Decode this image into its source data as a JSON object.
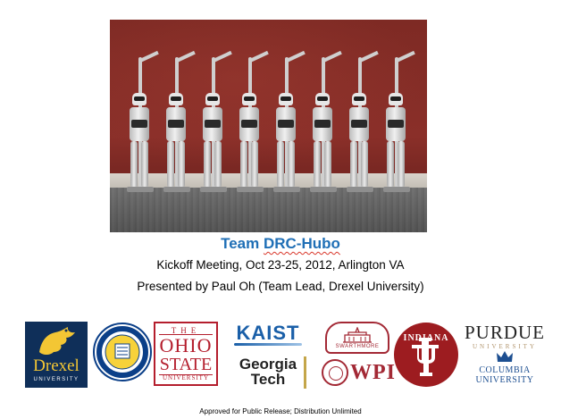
{
  "caption": {
    "title_prefix": "Team ",
    "title_name": "DRC-Hubo",
    "subtitle": "Kickoff Meeting, Oct 23-25, 2012, Arlington VA",
    "presenter": "Presented by Paul Oh (Team Lead, Drexel University)"
  },
  "photo": {
    "robot_count": 8,
    "alt_icon": "robot-photo"
  },
  "logos": {
    "drexel": {
      "name": "Drexel",
      "sub": "UNIVERSITY"
    },
    "delaware": {
      "name": "UNIVERSITY OF DELAWARE"
    },
    "ohio_state": {
      "the": "THE",
      "ohio": "OHIO",
      "state": "STATE",
      "univ": "UNIVERSITY"
    },
    "kaist": {
      "name": "KAIST"
    },
    "georgia_tech": {
      "line1": "Georgia",
      "line2": "Tech"
    },
    "swarthmore": {
      "name": "SWARTHMORE"
    },
    "wpi": {
      "name": "WPI"
    },
    "indiana": {
      "name": "INDIANA"
    },
    "purdue": {
      "name": "PURDUE",
      "sub": "UNIVERSITY"
    },
    "columbia": {
      "line1": "COLUMBIA",
      "line2": "UNIVERSITY"
    }
  },
  "footer": {
    "text": "Approved for Public Release; Distribution Unlimited"
  },
  "colors": {
    "title": "#1f6fb6",
    "drexel_navy": "#0f2f59",
    "drexel_gold": "#f3c634",
    "ohio_red": "#b41e2d",
    "indiana_crimson": "#9d1c20",
    "columbia_blue": "#1d4f91"
  }
}
